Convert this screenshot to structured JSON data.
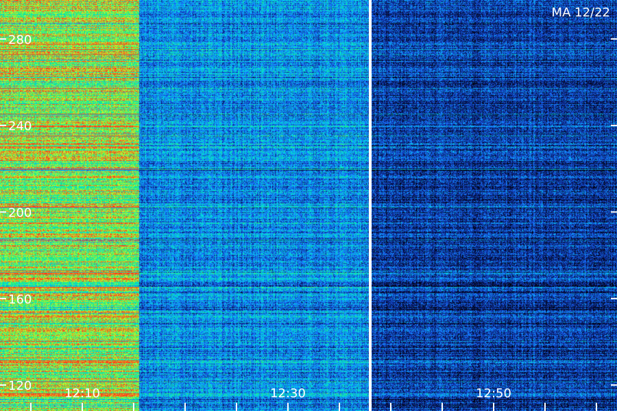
{
  "chart_data": {
    "type": "heatmap",
    "title": "MA 12/22",
    "xlabel": "",
    "ylabel": "",
    "x_tick_labels": [
      "12:10",
      "12:30",
      "12:50"
    ],
    "y_tick_labels": [
      "120",
      "160",
      "200",
      "240",
      "280"
    ],
    "y_ticks": [
      120,
      160,
      200,
      240,
      280
    ],
    "ylim": [
      108,
      298
    ],
    "x_ticks_minutes": [
      10,
      30,
      50
    ],
    "xlim_minutes": [
      2,
      62
    ],
    "minor_tick_interval_minutes": 5,
    "gap_at_minutes": 38,
    "grid": false,
    "colormap": [
      "#000000",
      "#0a1f7a",
      "#1a6cff",
      "#00d8e8",
      "#19f07a",
      "#c8ff2a",
      "#ff3a1a"
    ],
    "annotation_color": "#ffffff",
    "intensity_profile": [
      {
        "from_minutes": 2,
        "to_minutes": 15.5,
        "level": 0.78
      },
      {
        "from_minutes": 15.5,
        "to_minutes": 38,
        "level": 0.38
      },
      {
        "from_minutes": 38,
        "to_minutes": 62,
        "level": 0.22
      }
    ]
  }
}
